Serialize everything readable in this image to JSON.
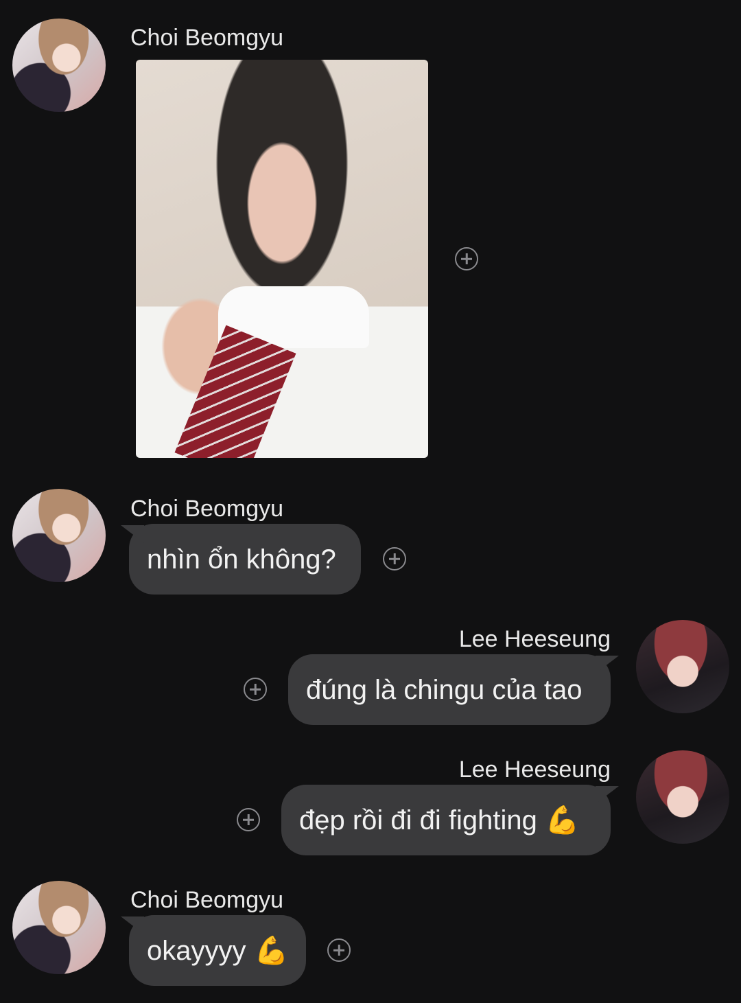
{
  "messages": [
    {
      "sender": "Choi Beomgyu",
      "type": "image",
      "avatar_icon": "avatar-beomgyu",
      "react_icon": "add-reaction-icon"
    },
    {
      "sender": "Choi Beomgyu",
      "type": "text",
      "text": "nhìn ổn không?",
      "react_icon": "add-reaction-icon"
    },
    {
      "sender": "Lee Heeseung",
      "type": "text",
      "text": "đúng là chingu của tao",
      "react_icon": "add-reaction-icon"
    },
    {
      "sender": "Lee Heeseung",
      "type": "text",
      "text": "đẹp rồi đi đi fighting",
      "emoji": "💪",
      "react_icon": "add-reaction-icon"
    },
    {
      "sender": "Choi Beomgyu",
      "type": "text",
      "text": "okayyyy",
      "emoji": "💪",
      "react_icon": "add-reaction-icon"
    }
  ],
  "colors": {
    "background": "#111112",
    "bubble": "#3a3a3c",
    "text": "#f2f2f2",
    "icon": "#8a8a8e"
  }
}
